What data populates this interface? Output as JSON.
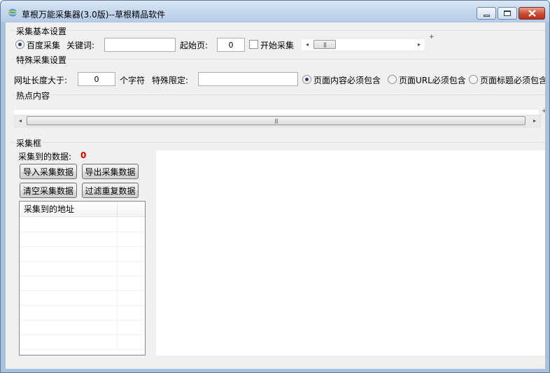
{
  "window": {
    "title": "草根万能采集器(3.0版)--草根精品软件",
    "minimize_label": "minimize",
    "maximize_label": "maximize",
    "close_label": "close"
  },
  "basic_settings": {
    "group_title": "采集基本设置",
    "baidu_radio_label": "百度采集",
    "baidu_selected": true,
    "keyword_label": "关键词:",
    "keyword_value": "",
    "start_page_label": "起始页:",
    "start_page_value": "0",
    "start_checkbox_label": "开始采集",
    "start_checked": false
  },
  "special_settings": {
    "group_title": "特殊采集设置",
    "url_length_label": "网址长度大于:",
    "url_length_value": "0",
    "chars_unit": "个字符",
    "special_limit_label": "特殊限定:",
    "special_limit_value": "",
    "options": [
      {
        "label": "页面内容必须包含",
        "selected": true
      },
      {
        "label": "页面URL必须包含",
        "selected": false
      },
      {
        "label": "页面标题必须包含",
        "selected": false
      }
    ]
  },
  "hot_content": {
    "group_title": "热点内容"
  },
  "collect_frame": {
    "group_title": "采集框",
    "count_label": "采集到的数据:",
    "count_value": "0",
    "count_color": "#cc0000",
    "buttons": {
      "import": "导入采集数据",
      "export": "导出采集数据",
      "clear": "清空采集数据",
      "dedupe": "过滤重复数据"
    },
    "list_columns": [
      "采集到的地址",
      ""
    ]
  },
  "icons": {
    "app": "app-globe-icon",
    "scroll_left": "◂",
    "scroll_right": "▸",
    "thumb_grip": "|||"
  }
}
